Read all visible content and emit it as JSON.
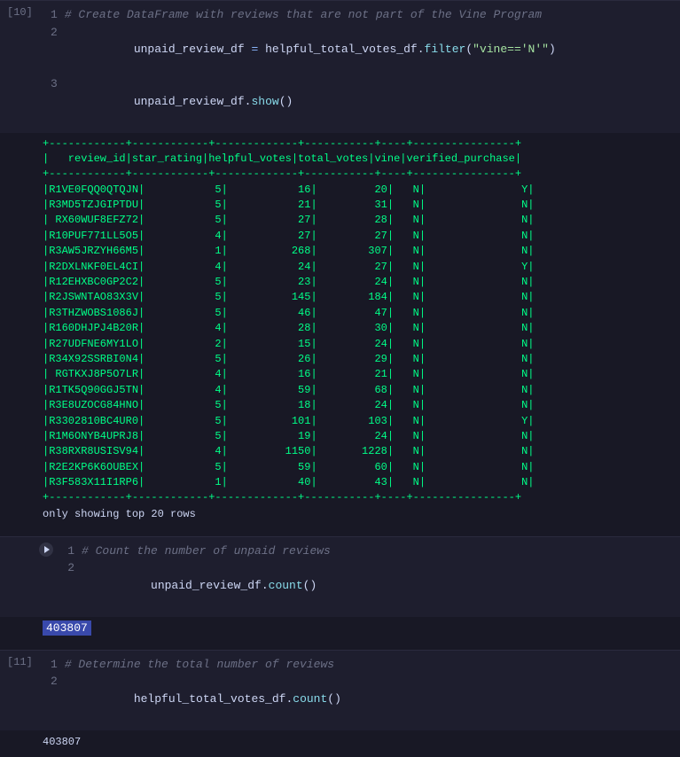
{
  "cells": [
    {
      "id": "cell-10",
      "label": "[10]",
      "type": "code-output",
      "lines": [
        {
          "num": 1,
          "tokens": [
            {
              "text": "# Create DataFrame with reviews that are not part of the Vine Program",
              "cls": "cm"
            }
          ]
        },
        {
          "num": 2,
          "tokens": [
            {
              "text": "unpaid_review_df",
              "cls": "va"
            },
            {
              "text": " = ",
              "cls": "op"
            },
            {
              "text": "helpful_total_votes_df",
              "cls": "va"
            },
            {
              "text": ".",
              "cls": "va"
            },
            {
              "text": "filter",
              "cls": "fn"
            },
            {
              "text": "(",
              "cls": "va"
            },
            {
              "text": "\"vine=='N'\"",
              "cls": "st"
            },
            {
              "text": ")",
              "cls": "va"
            }
          ]
        },
        {
          "num": 3,
          "tokens": [
            {
              "text": "unpaid_review_df",
              "cls": "va"
            },
            {
              "text": ".",
              "cls": "va"
            },
            {
              "text": "show",
              "cls": "fn"
            },
            {
              "text": "()",
              "cls": "va"
            }
          ]
        }
      ],
      "output_table": "+------------+------------+-------------+-----------+----+----------------+\n|   review_id|star_rating|helpful_votes|total_votes|vine|verified_purchase|\n+------------+------------+-------------+-----------+----+----------------+\n|R1VE0FQQ0QTQJN|           5|           16|         20|   N|               Y|\n|R3MD5TZJGIPTDU|           5|           21|         31|   N|               N|\n| RX60WUF8EFZ72|           5|           27|         28|   N|               N|\n|R10PUF771LL5O5|           4|           27|         27|   N|               N|\n|R3AW5JRZYH66M5|           1|          268|        307|   N|               N|\n|R2DXLNKF0EL4CI|           4|           24|         27|   N|               Y|\n|R12EHXBC0GP2C2|           5|           23|         24|   N|               N|\n|R2JSWNTAO83X3V|           5|          145|        184|   N|               N|\n|R3THZWOBS1086J|           5|           46|         47|   N|               N|\n|R160DHJPJ4B20R|           4|           28|         30|   N|               N|\n|R27UDFNE6MY1LO|           2|           15|         24|   N|               N|\n|R34X92SSRBI0N4|           5|           26|         29|   N|               N|\n| RGTKXJ8P5O7LR|           4|           16|         21|   N|               N|\n|R1TK5Q90GGJ5TN|           4|           59|         68|   N|               N|\n|R3E8UZOCG84HNO|           5|           18|         24|   N|               N|\n|R3302810BC4UR0|           5|          101|        103|   N|               Y|\n|R1M6ONYB4UPRJ8|           5|           19|         24|   N|               N|\n|R38RXR8USISV94|           4|         1150|       1228|   N|               N|\n|R2E2KP6K6OUBEX|           5|           59|         60|   N|               N|\n|R3F583X11I1RP6|           1|           40|         43|   N|               N|\n+------------+------------+-------------+-----------+----+----------------+",
      "output_note": "only showing top 20 rows"
    },
    {
      "id": "cell-run",
      "label": "",
      "type": "code-only",
      "has_run_btn": true,
      "lines": [
        {
          "num": 1,
          "tokens": [
            {
              "text": "# Count the number of unpaid reviews",
              "cls": "cm"
            }
          ]
        },
        {
          "num": 2,
          "tokens": [
            {
              "text": "unpaid_review_df",
              "cls": "va"
            },
            {
              "text": ".",
              "cls": "va"
            },
            {
              "text": "count",
              "cls": "fn"
            },
            {
              "text": "()",
              "cls": "va"
            }
          ]
        }
      ],
      "output_highlight": "403807"
    },
    {
      "id": "cell-11",
      "label": "[11]",
      "type": "code-output",
      "lines": [
        {
          "num": 1,
          "tokens": [
            {
              "text": "# Determine the total number of reviews",
              "cls": "cm"
            }
          ]
        },
        {
          "num": 2,
          "tokens": [
            {
              "text": "helpful_total_votes_df",
              "cls": "va"
            },
            {
              "text": ".",
              "cls": "va"
            },
            {
              "text": "count",
              "cls": "fn"
            },
            {
              "text": "()",
              "cls": "va"
            }
          ]
        }
      ],
      "output_plain": "403807"
    }
  ],
  "labels": {
    "only_showing": "only showing top 20 rows"
  }
}
